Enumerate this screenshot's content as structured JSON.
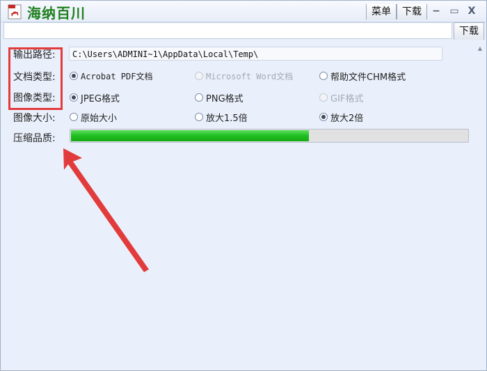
{
  "window": {
    "title": "海纳百川",
    "menu_label": "菜单",
    "download_label": "下载",
    "minimize_icon": "−",
    "maximize_icon": "▭",
    "close_icon": "X"
  },
  "toolbar": {
    "url_value": "",
    "download_label": "下载"
  },
  "form": {
    "output_path": {
      "label": "输出路径:",
      "value": "C:\\Users\\ADMINI~1\\AppData\\Local\\Temp\\"
    },
    "doc_type": {
      "label": "文档类型:",
      "options": [
        {
          "label": "Acrobat PDF文档",
          "checked": true,
          "disabled": false
        },
        {
          "label": "Microsoft Word文档",
          "checked": false,
          "disabled": true
        },
        {
          "label": "帮助文件CHM格式",
          "checked": false,
          "disabled": false
        }
      ]
    },
    "image_type": {
      "label": "图像类型:",
      "options": [
        {
          "label": "JPEG格式",
          "checked": true,
          "disabled": false
        },
        {
          "label": "PNG格式",
          "checked": false,
          "disabled": false
        },
        {
          "label": "GIF格式",
          "checked": false,
          "disabled": true
        }
      ]
    },
    "image_size": {
      "label": "图像大小:",
      "options": [
        {
          "label": "原始大小",
          "checked": false,
          "disabled": false
        },
        {
          "label": "放大1.5倍",
          "checked": false,
          "disabled": false
        },
        {
          "label": "放大2倍",
          "checked": true,
          "disabled": false
        }
      ]
    },
    "quality": {
      "label": "压缩品质:",
      "value_fraction": 0.6
    }
  },
  "annotation": {
    "color": "#e23b3b"
  }
}
